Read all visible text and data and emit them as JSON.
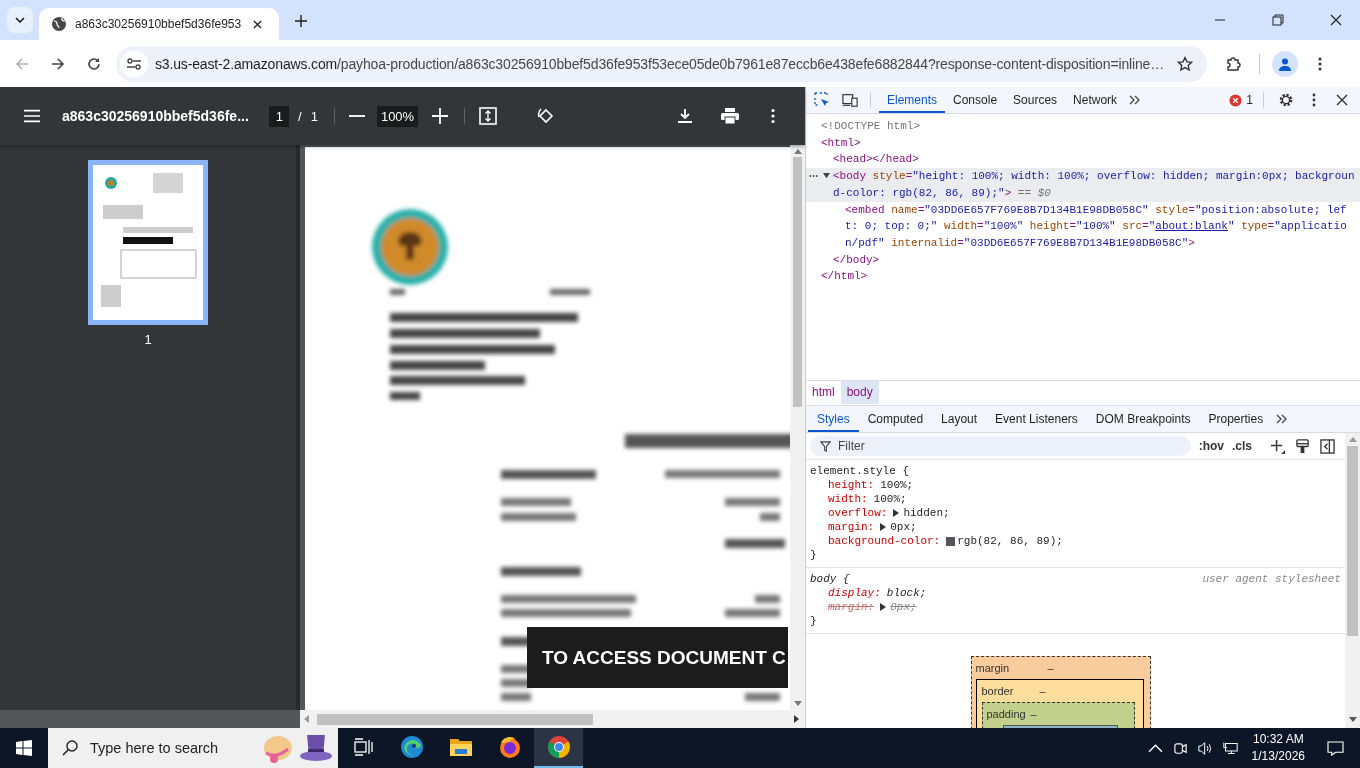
{
  "browser": {
    "tabs": [
      {
        "title": "a863c30256910bbef5d36fe953",
        "selected": true
      }
    ],
    "address": {
      "host": "s3.us-east-2.amazonaws.com",
      "path": "/payhoa-production/a863c30256910bbef5d36fe953f53ece05de0b7961e87eccb6e438efe6882844?response-content-disposition=inline…"
    }
  },
  "pdf_viewer": {
    "title": "a863c30256910bbef5d36fe...",
    "page": "1",
    "separator": "/",
    "page_count": "1",
    "zoom": "100%",
    "thumbnails": [
      {
        "label": "1",
        "selected": true
      }
    ],
    "overlay_text": "TO ACCESS DOCUMENT C"
  },
  "devtools": {
    "tabs": [
      {
        "label": "Elements",
        "selected": true
      },
      {
        "label": "Console",
        "selected": false
      },
      {
        "label": "Sources",
        "selected": false
      },
      {
        "label": "Network",
        "selected": false
      }
    ],
    "error_count": "1",
    "dom_tree": [
      {
        "line": [
          {
            "kind": "doctype",
            "text": "<!DOCTYPE html>"
          }
        ]
      },
      {
        "line": [
          {
            "kind": "tag",
            "text": "<html>"
          }
        ],
        "close": [
          {
            "kind": "tag",
            "text": "</html>"
          }
        ],
        "children": [
          {
            "line": [
              {
                "kind": "tag",
                "text": "<head></head>"
              }
            ]
          },
          {
            "expanded": true,
            "selected": true,
            "line": [
              {
                "kind": "tag",
                "text": "<body"
              },
              {
                "kind": "attr",
                "text": " style"
              },
              {
                "kind": "tag",
                "text": "="
              },
              {
                "kind": "value",
                "text": "\"height: 100%; width: 100%; overflow: hidden; margin:0px; background-color: rgb(82, 86, 89);\""
              },
              {
                "kind": "tag",
                "text": ">"
              },
              {
                "kind": "note",
                "text": " == $0"
              }
            ],
            "close": [
              {
                "kind": "tag",
                "text": "</body>"
              }
            ],
            "children": [
              {
                "line": [
                  {
                    "kind": "tag",
                    "text": "<embed"
                  },
                  {
                    "kind": "attr",
                    "text": " name"
                  },
                  {
                    "kind": "tag",
                    "text": "="
                  },
                  {
                    "kind": "value",
                    "text": "\"03DD6E657F769E8B7D134B1E98DB058C\""
                  },
                  {
                    "kind": "attr",
                    "text": " style"
                  },
                  {
                    "kind": "tag",
                    "text": "="
                  },
                  {
                    "kind": "value",
                    "text": "\"position:absolute; left: 0; top: 0;\""
                  },
                  {
                    "kind": "attr",
                    "text": " width"
                  },
                  {
                    "kind": "tag",
                    "text": "="
                  },
                  {
                    "kind": "value",
                    "text": "\"100%\""
                  },
                  {
                    "kind": "attr",
                    "text": " height"
                  },
                  {
                    "kind": "tag",
                    "text": "="
                  },
                  {
                    "kind": "value",
                    "text": "\"100%\""
                  },
                  {
                    "kind": "attr",
                    "text": " src"
                  },
                  {
                    "kind": "tag",
                    "text": "="
                  },
                  {
                    "kind": "value",
                    "text": "\""
                  },
                  {
                    "kind": "link",
                    "text": "about:blank"
                  },
                  {
                    "kind": "value",
                    "text": "\""
                  },
                  {
                    "kind": "attr",
                    "text": " type"
                  },
                  {
                    "kind": "tag",
                    "text": "="
                  },
                  {
                    "kind": "value",
                    "text": "\"application/pdf\""
                  },
                  {
                    "kind": "attr",
                    "text": " internalid"
                  },
                  {
                    "kind": "tag",
                    "text": "="
                  },
                  {
                    "kind": "value",
                    "text": "\"03DD6E657F769E8B7D134B1E98DB058C\""
                  },
                  {
                    "kind": "tag",
                    "text": ">"
                  }
                ]
              }
            ]
          }
        ]
      }
    ],
    "breadcrumbs": [
      {
        "label": "html",
        "selected": false
      },
      {
        "label": "body",
        "selected": true
      }
    ],
    "style_tabs": [
      {
        "label": "Styles",
        "selected": true
      },
      {
        "label": "Computed",
        "selected": false
      },
      {
        "label": "Layout",
        "selected": false
      },
      {
        "label": "Event Listeners",
        "selected": false
      },
      {
        "label": "DOM Breakpoints",
        "selected": false
      },
      {
        "label": "Properties",
        "selected": false
      }
    ],
    "filter": {
      "placeholder": "Filter"
    },
    "hov": ":hov",
    "cls": ".cls",
    "rules": [
      {
        "kind": "inline",
        "selector": "element.style {",
        "close": "}",
        "declarations": [
          {
            "property": "height:",
            "value": "100%;",
            "expandable": false,
            "struck": false
          },
          {
            "property": "width:",
            "value": "100%;",
            "expandable": false,
            "struck": false
          },
          {
            "property": "overflow:",
            "value": "hidden;",
            "expandable": true,
            "struck": false
          },
          {
            "property": "margin:",
            "value": "0px;",
            "expandable": true,
            "struck": false
          },
          {
            "property": "background-color:",
            "value": "rgb(82, 86, 89);",
            "expandable": false,
            "struck": false,
            "color": "#525659"
          }
        ]
      },
      {
        "kind": "user-agent",
        "selector": "body {",
        "origin": "user agent stylesheet",
        "close": "}",
        "declarations": [
          {
            "property": "display:",
            "value": "block;",
            "expandable": false,
            "struck": false
          },
          {
            "property": "margin:",
            "value": "8px;",
            "expandable": true,
            "struck": true
          }
        ]
      }
    ],
    "box_model": [
      {
        "label": "margin",
        "value": "–"
      },
      {
        "label": "border",
        "value": "–"
      },
      {
        "label": "padding",
        "value": "–"
      }
    ]
  },
  "taskbar": {
    "search_placeholder": "Type here to search",
    "apps": [
      {
        "kind": "task-view",
        "selected": false
      },
      {
        "kind": "edge",
        "selected": false
      },
      {
        "kind": "explorer",
        "selected": false
      },
      {
        "kind": "firefox",
        "selected": false
      },
      {
        "kind": "chrome",
        "selected": true
      }
    ],
    "time": "10:32 AM",
    "date": "1/13/2026"
  }
}
